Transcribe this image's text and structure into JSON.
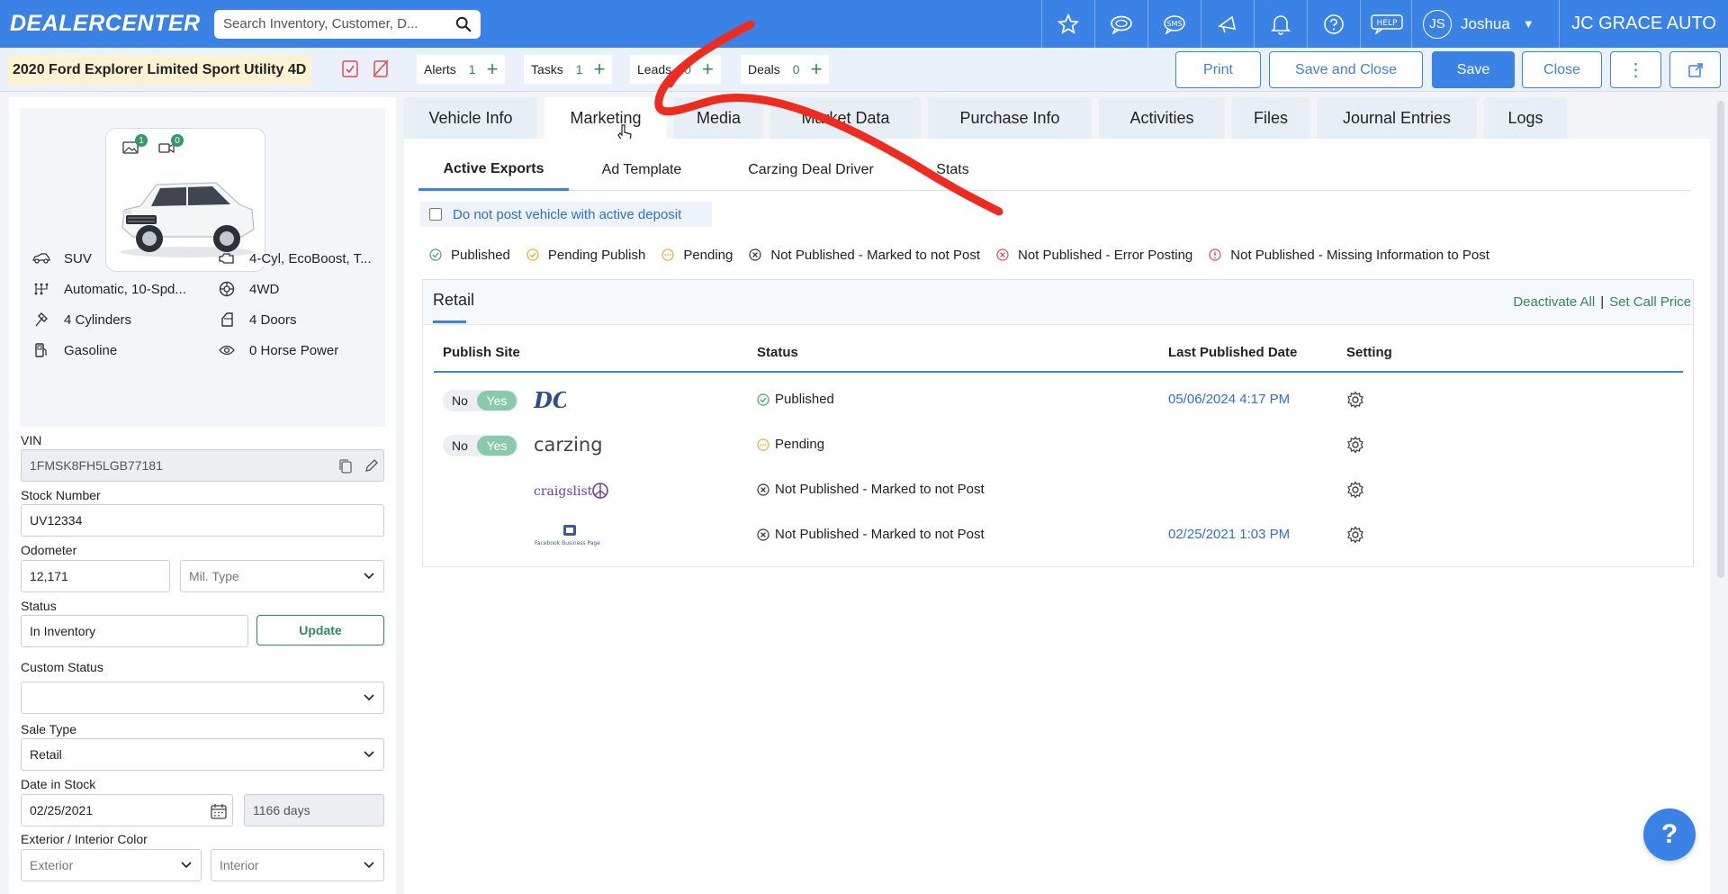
{
  "app": {
    "logo": "DEALERCENTER",
    "dealer_name": "JC GRACE AUTO"
  },
  "search": {
    "placeholder": "Search Inventory, Customer, D..."
  },
  "top_icons": [
    "star-icon",
    "chat-icon",
    "sms-icon",
    "megaphone-icon",
    "bell-icon",
    "question-icon",
    "help-icon"
  ],
  "top_labels": {
    "sms": "SMS",
    "help": "HELP"
  },
  "user": {
    "initials": "JS",
    "name": "Joshua"
  },
  "vehicle": {
    "title": "2020 Ford Explorer Limited Sport Utility 4D"
  },
  "counters": [
    {
      "label": "Alerts",
      "count": "1"
    },
    {
      "label": "Tasks",
      "count": "1"
    },
    {
      "label": "Leads",
      "count": "0"
    },
    {
      "label": "Deals",
      "count": "0"
    }
  ],
  "actions": {
    "print": "Print",
    "save_close": "Save and Close",
    "save": "Save",
    "close": "Close",
    "more": "⋮"
  },
  "photo": {
    "image_count": "1",
    "video_count": "0"
  },
  "specs": {
    "body": "SUV",
    "engine": "4-Cyl, EcoBoost, T...",
    "transmission": "Automatic, 10-Spd...",
    "drive": "4WD",
    "cylinders": "4 Cylinders",
    "doors": "4 Doors",
    "fuel": "Gasoline",
    "horsepower": "0 Horse Power"
  },
  "form": {
    "vin_label": "VIN",
    "vin": "1FMSK8FH5LGB77181",
    "stock_label": "Stock Number",
    "stock": "UV12334",
    "odometer_label": "Odometer",
    "odometer": "12,171",
    "mil_type": "Mil. Type",
    "status_label": "Status",
    "status": "In Inventory",
    "update": "Update",
    "custom_status_label": "Custom Status",
    "custom_status": "",
    "sale_type_label": "Sale Type",
    "sale_type": "Retail",
    "date_label": "Date in Stock",
    "date": "02/25/2021",
    "days": "1166 days",
    "color_label": "Exterior / Interior Color",
    "exterior": "Exterior",
    "interior": "Interior"
  },
  "tabs": [
    "Vehicle Info",
    "Marketing",
    "Media",
    "Market Data",
    "Purchase Info",
    "Activities",
    "Files",
    "Journal Entries",
    "Logs"
  ],
  "active_tab": "Marketing",
  "subtabs": [
    "Active Exports",
    "Ad Template",
    "Carzing Deal Driver",
    "Stats"
  ],
  "deposit_label": "Do not post vehicle with active deposit",
  "legend": [
    {
      "label": "Published",
      "icon": "check-circle-icon",
      "color": "#3aaa5c"
    },
    {
      "label": "Pending Publish",
      "icon": "check-circle-icon",
      "color": "#f0a830"
    },
    {
      "label": "Pending",
      "icon": "dots-circle-icon",
      "color": "#f0a830"
    },
    {
      "label": "Not Published - Marked to not Post",
      "icon": "x-circle-icon",
      "color": "#333333"
    },
    {
      "label": "Not Published - Error Posting",
      "icon": "x-circle-icon",
      "color": "#e04b4b"
    },
    {
      "label": "Not Published - Missing Information to Post",
      "icon": "exclaim-circle-icon",
      "color": "#e04b4b"
    }
  ],
  "retail": {
    "title": "Retail",
    "deactivate": "Deactivate All",
    "set_call_price": "Set Call Price",
    "columns": [
      "Publish Site",
      "Status",
      "Last Published Date",
      "Setting"
    ],
    "toggle_no": "No",
    "toggle_yes": "Yes",
    "rows": [
      {
        "site": "DC",
        "status": "Published",
        "date": "05/06/2024 4:17 PM"
      },
      {
        "site": "carzing",
        "status": "Pending",
        "date": ""
      },
      {
        "site": "craigslist",
        "status": "Not Published - Marked to not Post",
        "date": ""
      },
      {
        "site": "Facebook Business Page",
        "status": "Not Published - Marked to not Post",
        "date": "02/25/2021 1:03 PM"
      }
    ]
  },
  "help_fab": "?",
  "colors": {
    "primary": "#3b82e6",
    "green": "#2f8a5a",
    "annotation": "#ee2b1f"
  }
}
